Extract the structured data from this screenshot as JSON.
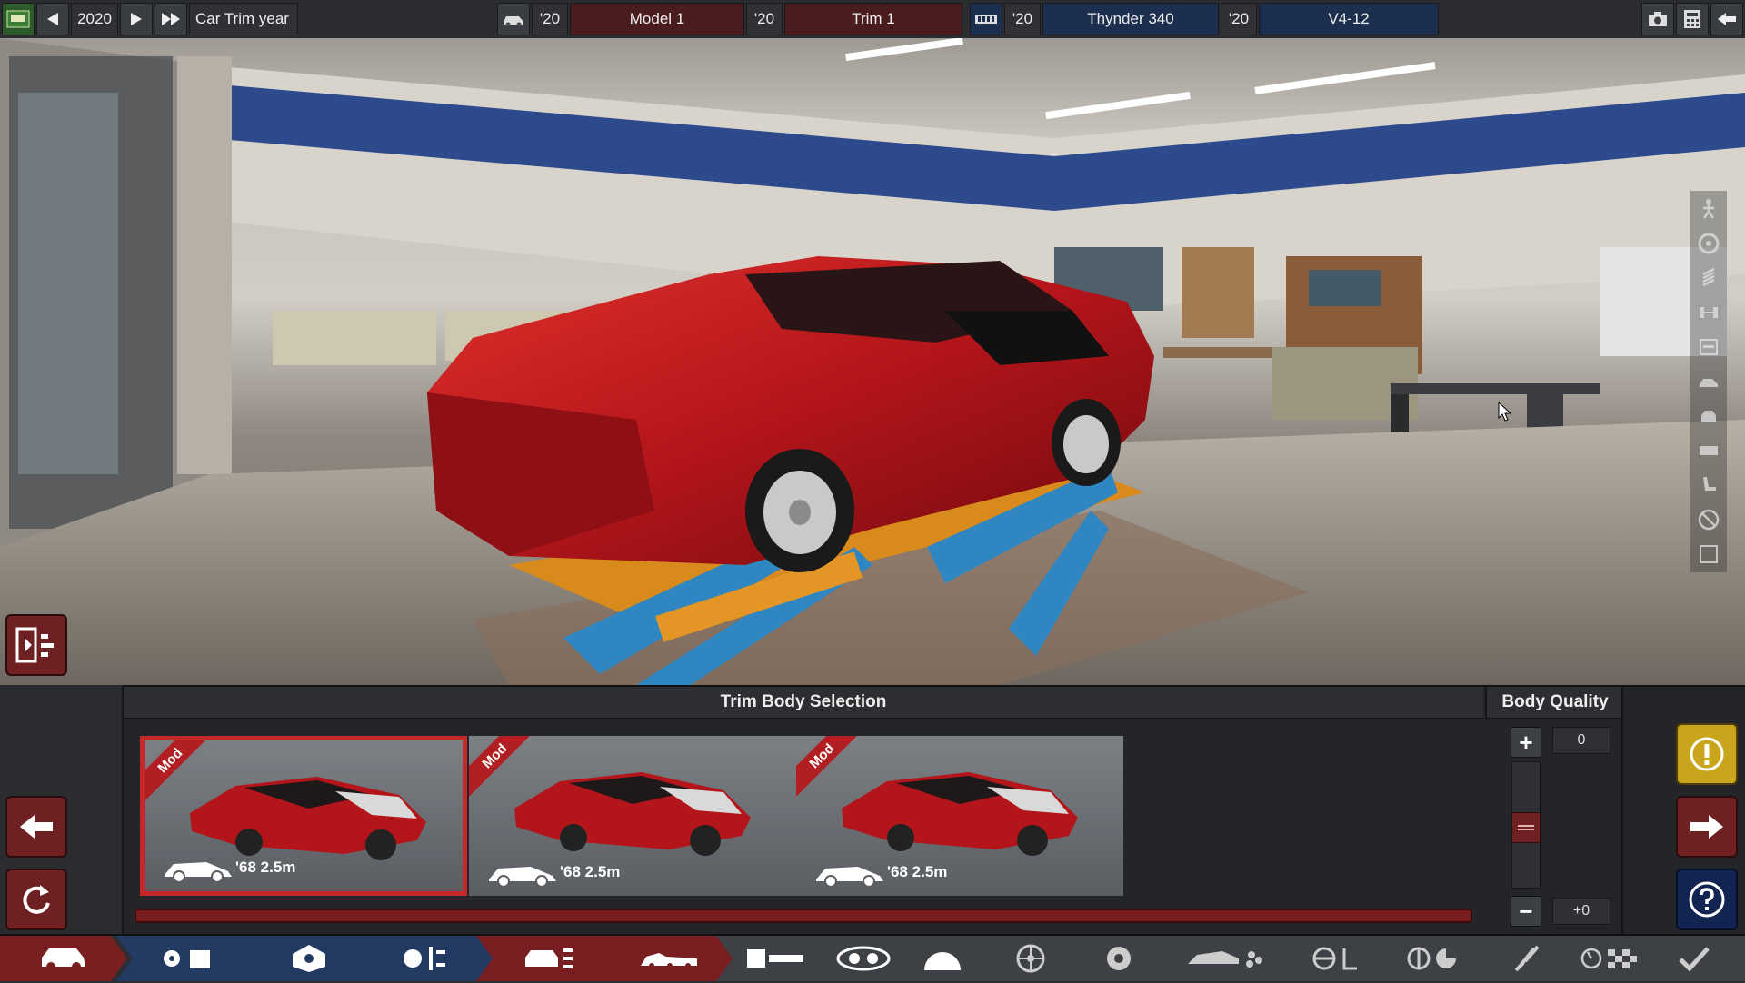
{
  "topbar": {
    "year": "2020",
    "year_label": "Car Trim year",
    "model_year": "'20",
    "model_name": "Model 1",
    "trim_year": "'20",
    "trim_name": "Trim 1",
    "engine_year": "'20",
    "engine_name": "Thynder 340",
    "variant_year": "'20",
    "variant_name": "V4-12"
  },
  "panel": {
    "title": "Trim Body Selection",
    "body_quality_title": "Body Quality",
    "body_quality_value": "0",
    "body_quality_delta": "+0",
    "cards": [
      {
        "tag": "Mod",
        "label": "'68 2.5m",
        "selected": true
      },
      {
        "tag": "Mod",
        "label": "'68 2.5m",
        "selected": false
      },
      {
        "tag": "Mod",
        "label": "'68 2.5m",
        "selected": false
      }
    ]
  },
  "tabs": [
    "car-icon",
    "engine-parts-icon",
    "engine-block-icon",
    "engine-config-icon",
    "chassis-icon",
    "body-icon",
    "fixtures-icon",
    "headlights-icon",
    "interior-icon",
    "wheels-icon",
    "brakes-icon",
    "aero-icon",
    "steering-icon",
    "suspension-icon",
    "tuning-icon",
    "test-track-icon",
    "checkmark-icon"
  ],
  "colors": {
    "accent_red": "#7a1f21",
    "accent_blue": "#233a63",
    "warning_yellow": "#c9a51c",
    "help_blue": "#122452"
  }
}
